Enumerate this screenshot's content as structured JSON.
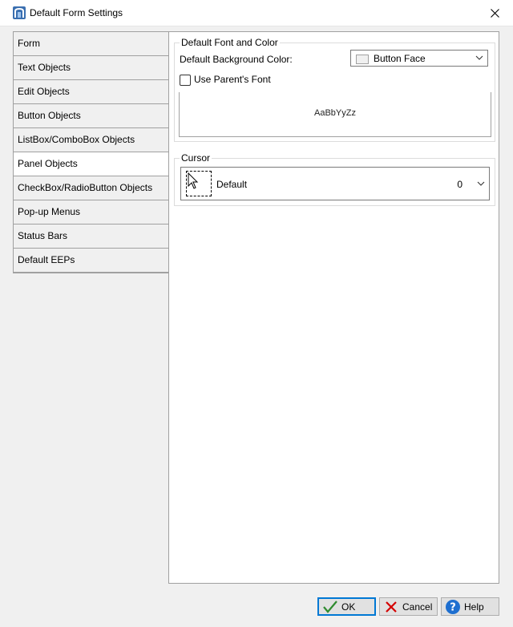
{
  "window": {
    "title": "Default Form Settings"
  },
  "sidebar": {
    "items": [
      {
        "label": "Form"
      },
      {
        "label": "Text Objects"
      },
      {
        "label": "Edit Objects"
      },
      {
        "label": "Button Objects"
      },
      {
        "label": "ListBox/ComboBox Objects"
      },
      {
        "label": "Panel Objects"
      },
      {
        "label": "CheckBox/RadioButton Objects"
      },
      {
        "label": "Pop-up Menus"
      },
      {
        "label": "Status Bars"
      },
      {
        "label": "Default EEPs"
      }
    ],
    "active_index": 5
  },
  "font_color": {
    "legend": "Default Font and Color",
    "bg_label": "Default Background Color:",
    "bg_value": "Button Face",
    "use_parent_font_label": "Use Parent's Font",
    "use_parent_font_checked": false,
    "preview_text": "AaBbYyZz"
  },
  "cursor": {
    "legend": "Cursor",
    "name": "Default",
    "value": "0"
  },
  "buttons": {
    "ok_label": "OK",
    "cancel_label": "Cancel",
    "help_label": "Help"
  },
  "colors": {
    "accent": "#0078d4",
    "ok_check": "#2e8b2e",
    "cancel_x": "#d40000",
    "help_circle": "#1e6fd0"
  },
  "icons": {
    "app": "form-app-icon",
    "close": "close-icon",
    "chevron": "chevron-down-icon",
    "cursor": "arrow-cursor-icon",
    "ok": "checkmark-icon",
    "cancel": "x-icon",
    "help": "question-icon"
  }
}
